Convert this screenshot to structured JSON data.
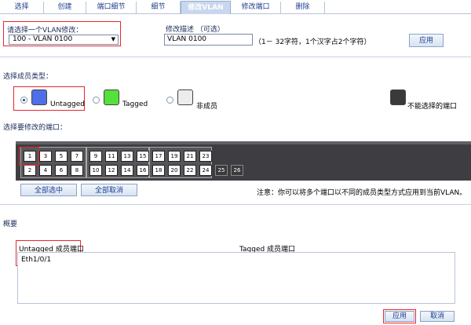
{
  "tabs": [
    {
      "label": "选择",
      "active": false
    },
    {
      "label": "创建",
      "active": false
    },
    {
      "label": "端口细节",
      "active": false
    },
    {
      "label": "细节",
      "active": false
    },
    {
      "label": "修改VLAN",
      "active": true
    },
    {
      "label": "修改端口",
      "active": false
    },
    {
      "label": "删除",
      "active": false
    }
  ],
  "vlan_select": {
    "label": "请选择一个VLAN修改：",
    "value": "100 - VLAN 0100"
  },
  "description": {
    "label": "修改描述 （可选）",
    "value": "VLAN 0100",
    "hint": "（1－ 32字符，1个汉字占2个字符）"
  },
  "apply_top": "应用",
  "member_type": {
    "label": "选择成员类型：",
    "options": [
      {
        "label": "Untagged",
        "color": "#4f6fe8",
        "selected": true
      },
      {
        "label": "Tagged",
        "color": "#55e03b",
        "selected": false
      },
      {
        "label": "非成员",
        "color": "#ececec",
        "selected": false
      }
    ],
    "unselectable": {
      "label": "不能选择的端口",
      "color": "#3a3a3a"
    }
  },
  "ports": {
    "label": "选择要修改的端口：",
    "top_row": [
      "1",
      "3",
      "5",
      "7",
      "9",
      "11",
      "13",
      "15",
      "17",
      "19",
      "21",
      "23"
    ],
    "bottom_row": [
      "2",
      "4",
      "6",
      "8",
      "10",
      "12",
      "14",
      "16",
      "18",
      "20",
      "22",
      "24"
    ],
    "extra": [
      "25",
      "26"
    ],
    "selected": [
      "1"
    ]
  },
  "select_all": "全部选中",
  "deselect_all": "全部取消",
  "note": "注意：你可以将多个端口以不同的成员类型方式应用到当前VLAN。",
  "summary": {
    "label": "概要",
    "untagged_label": "Untagged 成员端口",
    "tagged_label": "Tagged 成员端口",
    "untagged_ports": [
      "Eth1/0/1"
    ]
  },
  "apply_bottom": "应用",
  "cancel": "取消"
}
